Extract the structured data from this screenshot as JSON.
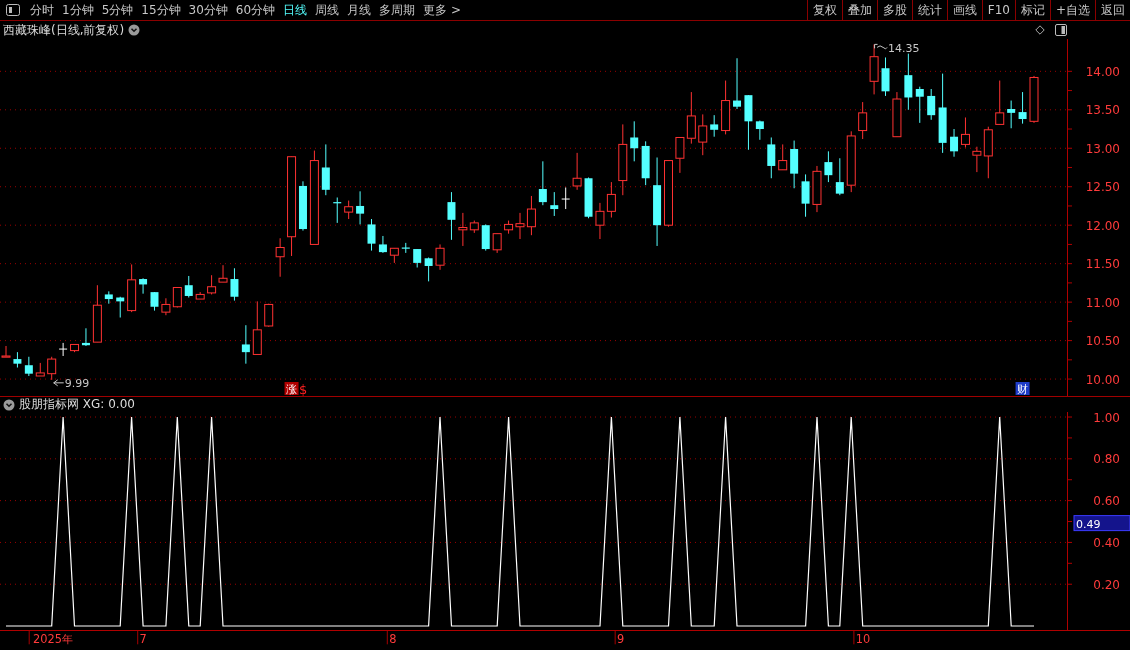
{
  "toolbar": {
    "periods": [
      {
        "label": "分时",
        "selected": false
      },
      {
        "label": "1分钟",
        "selected": false
      },
      {
        "label": "5分钟",
        "selected": false
      },
      {
        "label": "15分钟",
        "selected": false
      },
      {
        "label": "30分钟",
        "selected": false
      },
      {
        "label": "60分钟",
        "selected": false
      },
      {
        "label": "日线",
        "selected": true
      },
      {
        "label": "周线",
        "selected": false
      },
      {
        "label": "月线",
        "selected": false
      },
      {
        "label": "多周期",
        "selected": false
      },
      {
        "label": "更多 >",
        "selected": false
      }
    ],
    "buttons": [
      "复权",
      "叠加",
      "多股",
      "统计",
      "画线",
      "F10",
      "标记",
      "+自选",
      "返回"
    ]
  },
  "main_chart": {
    "title": "西藏珠峰(日线,前复权)",
    "chart_data": {
      "type": "candlestick",
      "grid": true,
      "ylim": [
        9.78,
        14.42
      ],
      "yticks": [
        {
          "value": 10,
          "label": "10.00"
        },
        {
          "value": 10.5,
          "label": "10.50"
        },
        {
          "value": 11,
          "label": "11.00"
        },
        {
          "value": 11.5,
          "label": "11.50"
        },
        {
          "value": 12,
          "label": "12.00"
        },
        {
          "value": 12.5,
          "label": "12.50"
        },
        {
          "value": 13,
          "label": "13.00"
        },
        {
          "value": 13.5,
          "label": "13.50"
        },
        {
          "value": 14,
          "label": "14.00"
        }
      ],
      "ohlc": [
        [
          10.29,
          10.43,
          10.29,
          10.3
        ],
        [
          10.26,
          10.35,
          10.15,
          10.2
        ],
        [
          10.18,
          10.29,
          10.04,
          10.07
        ],
        [
          10.04,
          10.21,
          10.04,
          10.08
        ],
        [
          10.07,
          10.29,
          9.99,
          10.26
        ],
        [
          10.39,
          10.47,
          10.3,
          10.39
        ],
        [
          10.37,
          10.45,
          10.35,
          10.45
        ],
        [
          10.47,
          10.66,
          10.43,
          10.44
        ],
        [
          10.48,
          11.22,
          10.48,
          10.96
        ],
        [
          11.1,
          11.14,
          10.98,
          11.04
        ],
        [
          11.06,
          11.07,
          10.8,
          11.01
        ],
        [
          10.89,
          11.49,
          10.87,
          11.29
        ],
        [
          11.3,
          11.31,
          11.11,
          11.23
        ],
        [
          11.13,
          11.13,
          10.89,
          10.94
        ],
        [
          10.87,
          11.05,
          10.83,
          10.97
        ],
        [
          10.94,
          11.19,
          10.93,
          11.19
        ],
        [
          11.22,
          11.34,
          11.06,
          11.08
        ],
        [
          11.04,
          11.13,
          11.04,
          11.1
        ],
        [
          11.12,
          11.35,
          11.1,
          11.2
        ],
        [
          11.26,
          11.48,
          11.26,
          11.31
        ],
        [
          11.3,
          11.44,
          11.02,
          11.07
        ],
        [
          10.45,
          10.7,
          10.2,
          10.35
        ],
        [
          10.32,
          11.01,
          10.32,
          10.64
        ],
        [
          10.69,
          10.98,
          10.68,
          10.97
        ],
        [
          11.59,
          11.83,
          11.33,
          11.71
        ],
        [
          11.85,
          12.89,
          11.6,
          12.89
        ],
        [
          12.51,
          12.57,
          11.93,
          11.95
        ],
        [
          11.75,
          12.97,
          11.75,
          12.84
        ],
        [
          12.75,
          13.05,
          12.39,
          12.46
        ],
        [
          12.3,
          12.36,
          12.03,
          12.29
        ],
        [
          12.17,
          12.32,
          12.08,
          12.24
        ],
        [
          12.25,
          12.44,
          12.01,
          12.15
        ],
        [
          12.01,
          12.08,
          11.67,
          11.76
        ],
        [
          11.75,
          11.86,
          11.64,
          11.65
        ],
        [
          11.61,
          11.7,
          11.51,
          11.7
        ],
        [
          11.71,
          11.77,
          11.64,
          11.7
        ],
        [
          11.69,
          11.69,
          11.45,
          11.51
        ],
        [
          11.57,
          11.58,
          11.27,
          11.47
        ],
        [
          11.48,
          11.75,
          11.42,
          11.7
        ],
        [
          12.3,
          12.43,
          11.81,
          12.07
        ],
        [
          11.94,
          12.16,
          11.73,
          11.97
        ],
        [
          11.94,
          12.06,
          11.9,
          12.03
        ],
        [
          12.0,
          12.01,
          11.67,
          11.69
        ],
        [
          11.68,
          11.89,
          11.64,
          11.89
        ],
        [
          11.94,
          12.06,
          11.89,
          12.01
        ],
        [
          11.98,
          12.16,
          11.82,
          12.02
        ],
        [
          11.98,
          12.38,
          11.87,
          12.21
        ],
        [
          12.47,
          12.83,
          12.26,
          12.3
        ],
        [
          12.26,
          12.43,
          12.12,
          12.21
        ],
        [
          12.34,
          12.49,
          12.21,
          12.34
        ],
        [
          12.51,
          12.94,
          12.46,
          12.61
        ],
        [
          12.61,
          12.62,
          12.09,
          12.11
        ],
        [
          12.0,
          12.29,
          11.82,
          12.18
        ],
        [
          12.18,
          12.56,
          12.1,
          12.4
        ],
        [
          12.58,
          13.31,
          12.39,
          13.05
        ],
        [
          13.14,
          13.35,
          12.83,
          13.0
        ],
        [
          13.03,
          13.09,
          12.52,
          12.61
        ],
        [
          12.52,
          12.88,
          11.73,
          12.0
        ],
        [
          12.0,
          12.84,
          11.98,
          12.84
        ],
        [
          12.87,
          13.14,
          12.68,
          13.14
        ],
        [
          13.13,
          13.73,
          13.06,
          13.42
        ],
        [
          13.08,
          13.44,
          12.91,
          13.29
        ],
        [
          13.31,
          13.43,
          13.15,
          13.24
        ],
        [
          13.23,
          13.88,
          13.18,
          13.62
        ],
        [
          13.62,
          14.17,
          13.51,
          13.54
        ],
        [
          13.69,
          13.69,
          12.98,
          13.35
        ],
        [
          13.35,
          13.36,
          13.11,
          13.25
        ],
        [
          13.05,
          13.14,
          12.61,
          12.77
        ],
        [
          12.72,
          13.05,
          12.72,
          12.84
        ],
        [
          12.99,
          13.1,
          12.48,
          12.67
        ],
        [
          12.57,
          12.66,
          12.11,
          12.28
        ],
        [
          12.27,
          12.77,
          12.17,
          12.7
        ],
        [
          12.82,
          12.96,
          12.56,
          12.65
        ],
        [
          12.56,
          12.87,
          12.39,
          12.41
        ],
        [
          12.52,
          13.22,
          12.43,
          13.16
        ],
        [
          13.23,
          13.6,
          13.12,
          13.46
        ],
        [
          13.87,
          14.35,
          13.7,
          14.19
        ],
        [
          14.04,
          14.18,
          13.68,
          13.74
        ],
        [
          13.15,
          13.73,
          13.15,
          13.64
        ],
        [
          13.95,
          14.23,
          13.5,
          13.66
        ],
        [
          13.77,
          13.8,
          13.33,
          13.67
        ],
        [
          13.68,
          13.77,
          13.37,
          13.43
        ],
        [
          13.53,
          13.97,
          12.94,
          13.07
        ],
        [
          13.15,
          13.25,
          12.89,
          12.96
        ],
        [
          13.05,
          13.4,
          13.01,
          13.18
        ],
        [
          12.91,
          13.02,
          12.69,
          12.96
        ],
        [
          12.9,
          13.28,
          12.61,
          13.24
        ],
        [
          13.31,
          13.88,
          13.31,
          13.46
        ],
        [
          13.51,
          13.62,
          13.26,
          13.46
        ],
        [
          13.47,
          13.73,
          13.32,
          13.38
        ],
        [
          13.35,
          13.94,
          13.33,
          13.92
        ]
      ],
      "annotations": [
        "9.99",
        "14.35"
      ]
    },
    "events": [
      {
        "kind": "badge",
        "label": "涨",
        "color": "#b00000"
      },
      {
        "kind": "glyph",
        "label": "$",
        "color": "#ff2020"
      },
      {
        "kind": "badge",
        "label": "财",
        "color": "#1e3cc8"
      }
    ]
  },
  "indicator": {
    "title": "股朋指标网 XG: 0.00",
    "readout": "0.49",
    "date_axis": [
      {
        "label": "2025年"
      },
      {
        "label": "7"
      },
      {
        "label": "8"
      },
      {
        "label": "9"
      },
      {
        "label": "10"
      }
    ],
    "chart_data": {
      "type": "line",
      "grid": true,
      "ylim": [
        -0.019,
        1.024
      ],
      "yticks": [
        {
          "value": 0.2,
          "label": "0.20"
        },
        {
          "value": 0.4,
          "label": "0.40"
        },
        {
          "value": 0.6,
          "label": "0.60"
        },
        {
          "value": 0.8,
          "label": "0.80"
        },
        {
          "value": 1,
          "label": "1.00"
        }
      ],
      "series": [
        {
          "color": "#ffffff",
          "values": [
            0,
            0,
            0,
            0,
            0,
            1,
            0,
            0,
            0,
            0,
            0,
            1,
            0,
            0,
            0,
            1,
            0,
            0,
            1,
            0,
            0,
            0,
            0,
            0,
            0,
            0,
            0,
            0,
            0,
            0,
            0,
            0,
            0,
            0,
            0,
            0,
            0,
            0,
            1,
            0,
            0,
            0,
            0,
            0,
            1,
            0,
            0,
            0,
            0,
            0,
            0,
            0,
            0,
            1,
            0,
            0,
            0,
            0,
            0,
            1,
            0,
            0,
            0,
            1,
            0,
            0,
            0,
            0,
            0,
            0,
            0,
            1,
            0,
            0,
            1,
            0,
            0,
            0,
            0,
            0,
            0,
            0,
            0,
            0,
            0,
            0,
            0,
            1,
            0,
            0,
            0
          ]
        }
      ]
    }
  }
}
